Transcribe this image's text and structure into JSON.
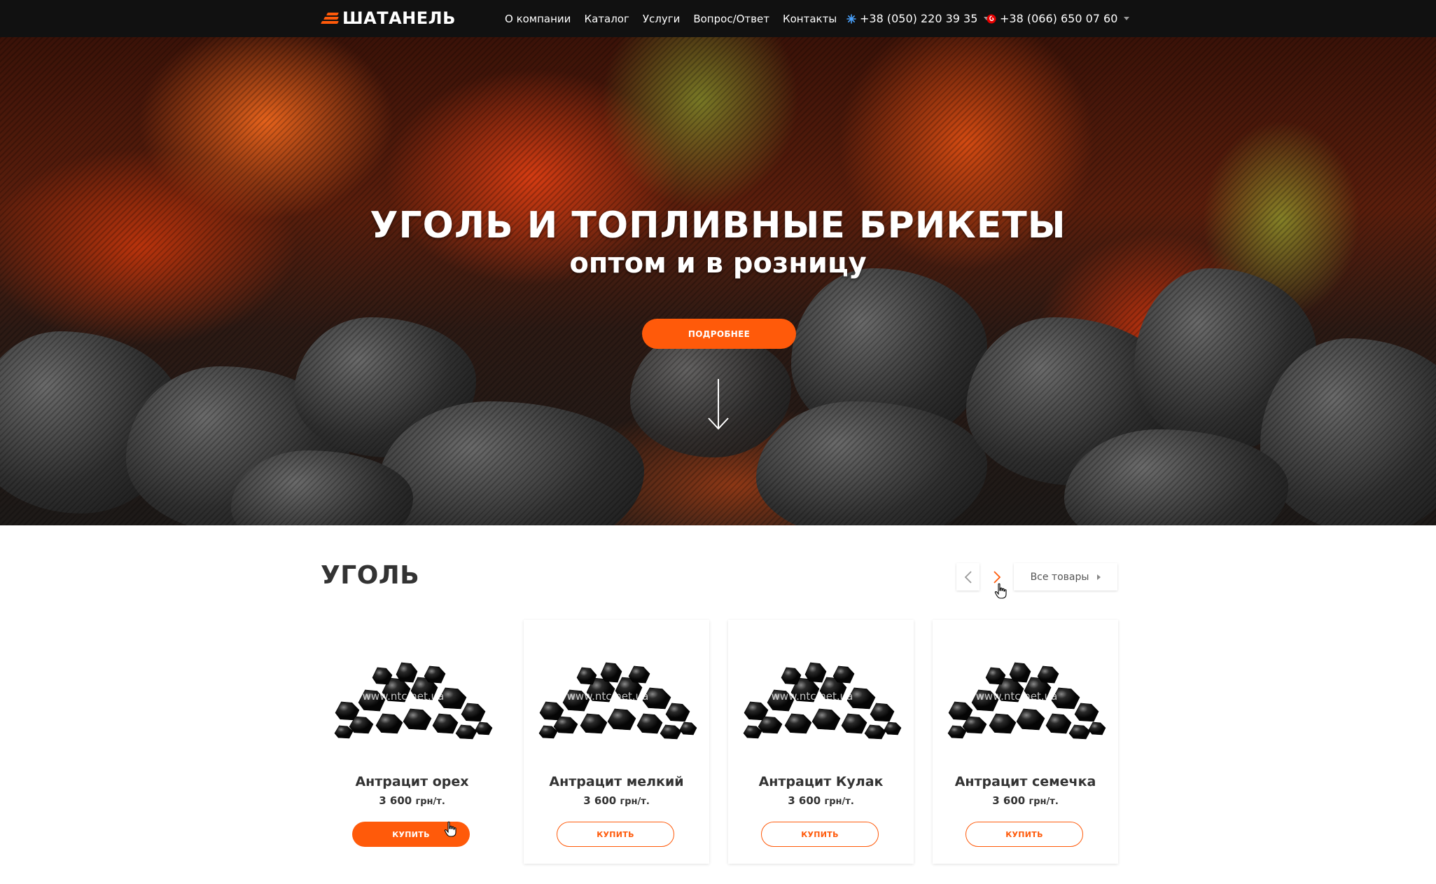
{
  "header": {
    "logo_text": "ШАТАНЕЛЬ",
    "nav": [
      "О компании",
      "Каталог",
      "Услуги",
      "Вопрос/Ответ",
      "Контакты"
    ],
    "phones": [
      "+38 (050) 220 39 35",
      "+38 (066) 650 07 60"
    ]
  },
  "hero": {
    "title": "УГОЛЬ И ТОПЛИВНЫЕ БРИКЕТЫ",
    "subtitle": "оптом и в розницу",
    "button": "ПОДРОБНЕЕ"
  },
  "section": {
    "title": "УГОЛЬ",
    "all_label": "Все товары"
  },
  "products": [
    {
      "name": "Антрацит орех",
      "price": "3 600",
      "unit": "грн/т.",
      "buy": "КУПИТЬ",
      "watermark": "www.ntc.net.ua"
    },
    {
      "name": "Антрацит мелкий",
      "price": "3 600",
      "unit": "грн/т.",
      "buy": "КУПИТЬ",
      "watermark": "www.ntc.net.ua"
    },
    {
      "name": "Антрацит Кулак",
      "price": "3 600",
      "unit": "грн/т.",
      "buy": "КУПИТЬ",
      "watermark": "www.ntc.net.ua"
    },
    {
      "name": "Антрацит семечка",
      "price": "3 600",
      "unit": "грн/т.",
      "buy": "КУПИТЬ",
      "watermark": "www.ntc.net.ua"
    }
  ],
  "colors": {
    "accent": "#ff5a0a",
    "topbar": "#111111",
    "text": "#333333"
  },
  "icons": [
    "logo-stripes-icon",
    "kyivstar-star-icon",
    "vodafone-icon",
    "chevron-down-icon",
    "arrow-down-icon",
    "chevron-left-icon",
    "chevron-right-icon",
    "hand-cursor-icon"
  ]
}
